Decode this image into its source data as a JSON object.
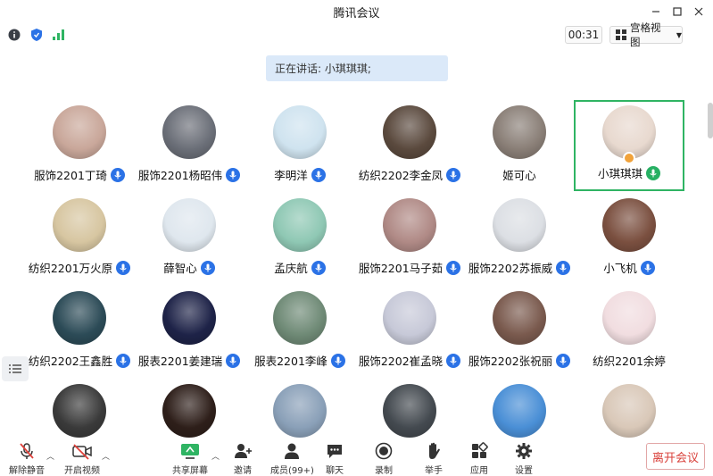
{
  "window": {
    "title": "腾讯会议"
  },
  "toolbar": {
    "timer": "00:31",
    "view_label": "宫格视图",
    "info_icon": "info-icon",
    "shield_icon": "shield-icon",
    "signal_icon": "signal-icon"
  },
  "speaking": {
    "text": "正在讲话: 小琪琪琪;"
  },
  "participants": [
    {
      "name": "服饰2201丁琦",
      "avatar_color": "#c9a79a",
      "mic": "blue"
    },
    {
      "name": "服饰2201杨昭伟",
      "avatar_color": "#6b6f78",
      "mic": "blue"
    },
    {
      "name": "李明洋",
      "avatar_color": "#cfe3ef",
      "mic": "blue"
    },
    {
      "name": "纺织2202李金凤",
      "avatar_color": "#5b4a3e",
      "mic": "blue"
    },
    {
      "name": "姬可心",
      "avatar_color": "#8a7f77",
      "mic": "none"
    },
    {
      "name": "小琪琪琪",
      "avatar_color": "#e8d9cf",
      "mic": "green",
      "active": true
    },
    {
      "name": "纺织2201万火原",
      "avatar_color": "#d7c6a1",
      "mic": "blue"
    },
    {
      "name": "薛智心",
      "avatar_color": "#dfe7ee",
      "mic": "blue"
    },
    {
      "name": "孟庆航",
      "avatar_color": "#8fc8b4",
      "mic": "blue"
    },
    {
      "name": "服饰2201马子茹",
      "avatar_color": "#b08a86",
      "mic": "blue"
    },
    {
      "name": "服饰2202苏振威",
      "avatar_color": "#dcdfe4",
      "mic": "blue"
    },
    {
      "name": "小飞机",
      "avatar_color": "#7b5040",
      "mic": "blue"
    },
    {
      "name": "纺织2202王鑫胜",
      "avatar_color": "#2c4b57",
      "mic": "blue"
    },
    {
      "name": "服表2201姜建瑞",
      "avatar_color": "#1e2348",
      "mic": "blue"
    },
    {
      "name": "服表2201李峰",
      "avatar_color": "#6f8a76",
      "mic": "blue"
    },
    {
      "name": "服饰2202崔孟晓",
      "avatar_color": "#c7c9d8",
      "mic": "blue"
    },
    {
      "name": "服饰2202张祝丽",
      "avatar_color": "#7a5a4e",
      "mic": "blue"
    },
    {
      "name": "纺织2201余婷",
      "avatar_color": "#f1dde0",
      "mic": "none"
    },
    {
      "name": "",
      "avatar_color": "#3a3a3a",
      "mic": "none"
    },
    {
      "name": "",
      "avatar_color": "#2e1f1a",
      "mic": "none"
    },
    {
      "name": "",
      "avatar_color": "#8aa0b8",
      "mic": "none"
    },
    {
      "name": "",
      "avatar_color": "#444a50",
      "mic": "none"
    },
    {
      "name": "",
      "avatar_color": "#4a8fd6",
      "mic": "none"
    },
    {
      "name": "",
      "avatar_color": "#d9c8b8",
      "mic": "none"
    }
  ],
  "bottombar": {
    "unmute": "解除静音",
    "start_video": "开启视频",
    "share_screen": "共享屏幕",
    "invite": "邀请",
    "members": "成员(99+)",
    "chat": "聊天",
    "record": "录制",
    "raise_hand": "举手",
    "apps": "应用",
    "settings": "设置",
    "leave": "离开会议"
  },
  "colors": {
    "accent": "#2b72e6",
    "active_border": "#2fb463",
    "leave": "#d9403a",
    "speaking_bg": "#dbe9f9"
  }
}
